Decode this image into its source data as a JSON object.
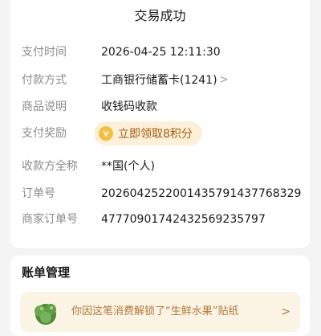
{
  "status": {
    "title": "交易成功"
  },
  "details": [
    {
      "label": "支付时间",
      "value": "2026-04-25 12:11:30"
    },
    {
      "label": "付款方式",
      "value": "工商银行储蓄卡(1241)",
      "has_chevron": true
    },
    {
      "label": "商品说明",
      "value": "收钱码收款"
    },
    {
      "label": "支付奖励",
      "value": "立即领取8积分"
    },
    {
      "label": "收款方全称",
      "value": "**国(个人)"
    },
    {
      "label": "订单号",
      "value": "20260425220014357914377683​29"
    },
    {
      "label": "商家订单号",
      "value": "477709017424325692357​97"
    }
  ],
  "bill": {
    "title": "账单管理",
    "promo_text": "你因这笔消费解锁了“生鲜水果”贴纸"
  },
  "colors": {
    "accent": "#a45a12",
    "reward_bg": "#fdf0d8",
    "coin": "#f3bf43",
    "promo_bg": "#fbf3e3"
  }
}
